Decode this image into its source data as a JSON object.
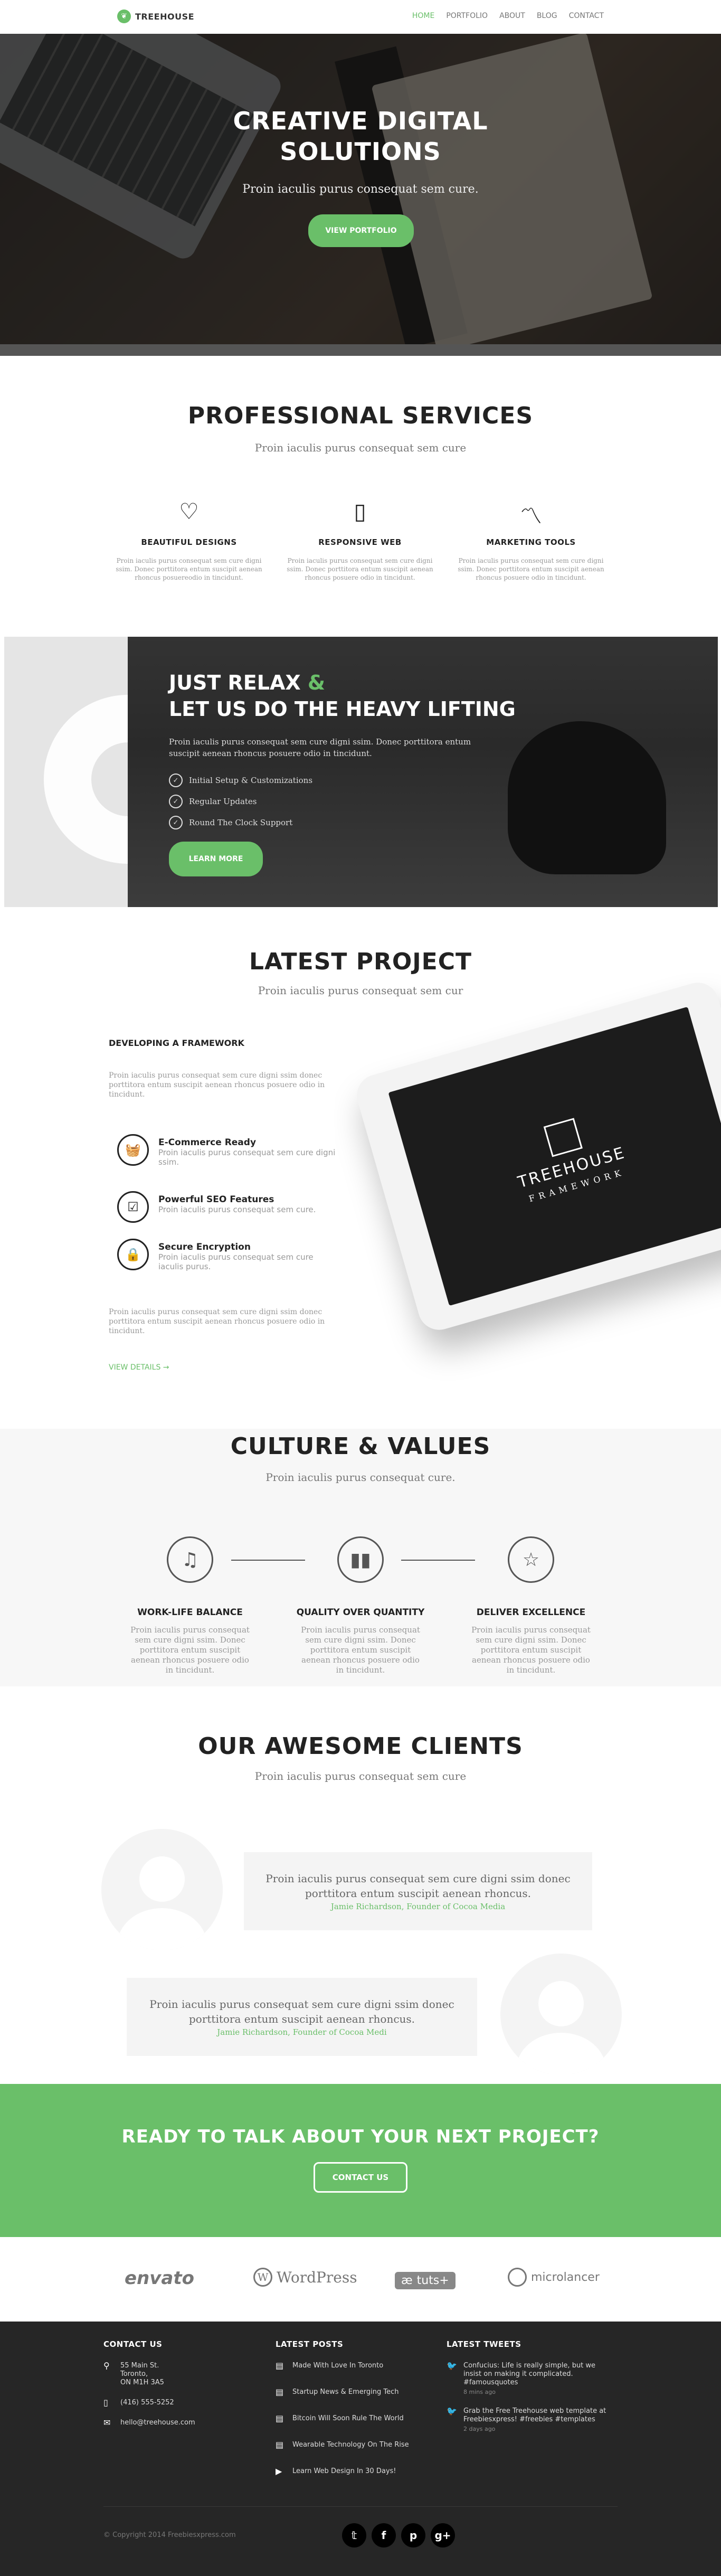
{
  "nav": {
    "logo": "TREEHOUSE",
    "items": [
      "HOME",
      "PORTFOLIO",
      "ABOUT",
      "BLOG",
      "CONTACT"
    ]
  },
  "hero": {
    "title_line1": "CREATIVE DIGITAL",
    "title_line2": "SOLUTIONS",
    "subtitle": "Proin iaculis purus consequat sem cure.",
    "button": "VIEW PORTFOLIO"
  },
  "services": {
    "title": "PROFESSIONAL SERVICES",
    "subtitle": "Proin iaculis purus consequat sem cure",
    "items": [
      {
        "icon": "heart-icon",
        "title": "BEAUTIFUL DESIGNS",
        "text": "Proin iaculis purus consequat sem cure digni ssim. Donec porttitora entum suscipit aenean rhoncus posuereodio in tincidunt."
      },
      {
        "icon": "tablet-icon",
        "title": "RESPONSIVE WEB",
        "text": "Proin iaculis purus consequat sem cure digni ssim. Donec porttitora entum suscipit aenean rhoncus posuere odio in tincidunt."
      },
      {
        "icon": "chart-line-icon",
        "title": "MARKETING TOOLS",
        "text": "Proin iaculis purus consequat sem cure digni ssim. Donec porttitora entum suscipit aenean rhoncus posuere odio in tincidunt."
      }
    ]
  },
  "relax": {
    "line1": "JUST RELAX ",
    "amp": "&",
    "line2": "LET US DO THE HEAVY LIFTING",
    "desc": "Proin iaculis purus consequat sem cure digni ssim. Donec porttitora entum suscipit aenean rhoncus posuere odio in tincidunt.",
    "checks": [
      "Initial Setup & Customizations",
      "Regular Updates",
      "Round The Clock Support"
    ],
    "button": "LEARN MORE"
  },
  "project": {
    "title": "LATEST PROJECT",
    "subtitle": "Proin iaculis purus consequat sem cur",
    "heading": "DEVELOPING A FRAMEWORK",
    "intro": "Proin iaculis purus consequat sem cure digni ssim donec porttitora entum suscipit aenean rhoncus posuere odio in tincidunt.",
    "features": [
      {
        "icon": "basket-icon",
        "title": "E-Commerce Ready",
        "text": "Proin iaculis purus consequat sem cure digni ssim."
      },
      {
        "icon": "checkbox-icon",
        "title": "Powerful SEO Features",
        "text": "Proin iaculis purus consequat sem cure."
      },
      {
        "icon": "lock-icon",
        "title": "Secure Encryption",
        "text": "Proin iaculis purus consequat sem cure iaculis purus."
      }
    ],
    "outro": "Proin iaculis purus consequat sem cure digni ssim donec porttitora entum suscipit aenean rhoncus posuere odio in tincidunt.",
    "link": "VIEW DETAILS →",
    "tablet": {
      "brand": "TREEHOUSE",
      "tag": "FRAMEWORK"
    }
  },
  "culture": {
    "title": "CULTURE & VALUES",
    "subtitle": "Proin iaculis purus consequat cure.",
    "items": [
      {
        "icon": "music-note-icon",
        "title": "WORK-LIFE BALANCE",
        "text": "Proin iaculis purus consequat sem cure digni ssim. Donec porttitora entum suscipit aenean rhoncus posuere odio in tincidunt."
      },
      {
        "icon": "bar-chart-icon",
        "title": "QUALITY OVER QUANTITY",
        "text": "Proin iaculis purus consequat sem cure digni ssim. Donec porttitora entum suscipit aenean rhoncus posuere odio in tincidunt."
      },
      {
        "icon": "star-icon",
        "title": "DELIVER EXCELLENCE",
        "text": "Proin iaculis purus consequat sem cure digni ssim. Donec porttitora entum suscipit aenean rhoncus posuere odio in tincidunt."
      }
    ]
  },
  "clients": {
    "title": "OUR AWESOME CLIENTS",
    "subtitle": "Proin iaculis purus consequat sem cure",
    "testimonials": [
      {
        "quote": "Proin iaculis purus consequat sem cure digni ssim donec porttitora entum suscipit aenean rhoncus.",
        "author": "Jamie Richardson, Founder of Cocoa Media"
      },
      {
        "quote": "Proin iaculis purus consequat sem cure digni ssim donec porttitora entum suscipit aenean rhoncus.",
        "author": "Jamie Richardson, Founder of Cocoa Medi"
      }
    ]
  },
  "cta": {
    "title": "READY TO TALK ABOUT YOUR NEXT PROJECT?",
    "button": "CONTACT US"
  },
  "partners": [
    "envato",
    "WordPress",
    "tuts+",
    "microlancer"
  ],
  "footer": {
    "contact": {
      "title": "CONTACT US",
      "address1": "55 Main St.",
      "address2": "Toronto,",
      "address3": "ON M1H 3A5",
      "phone": "(416) 555-5252",
      "email": "hello@treehouse.com"
    },
    "posts": {
      "title": "LATEST POSTS",
      "items": [
        "Made With Love In Toronto",
        "Startup News & Emerging Tech",
        "Bitcoin Will Soon Rule The World",
        "Wearable Technology On The Rise",
        "Learn Web Design In 30 Days!"
      ]
    },
    "tweets": {
      "title": "LATEST TWEETS",
      "items": [
        {
          "text": "Confucius: Life is really simple, but we insist on making it complicated. #famousquotes",
          "date": "8 mins ago"
        },
        {
          "text": "Grab the Free Treehouse web template at Freebiesxpress! #freebies #templates",
          "date": "2 days ago"
        }
      ]
    },
    "copyright": "© Copyright 2014 Freebiesxpress.com",
    "social": [
      "twitter",
      "facebook",
      "pinterest",
      "google-plus"
    ]
  },
  "colors": {
    "accent": "#6abf69",
    "dark": "#262626"
  }
}
